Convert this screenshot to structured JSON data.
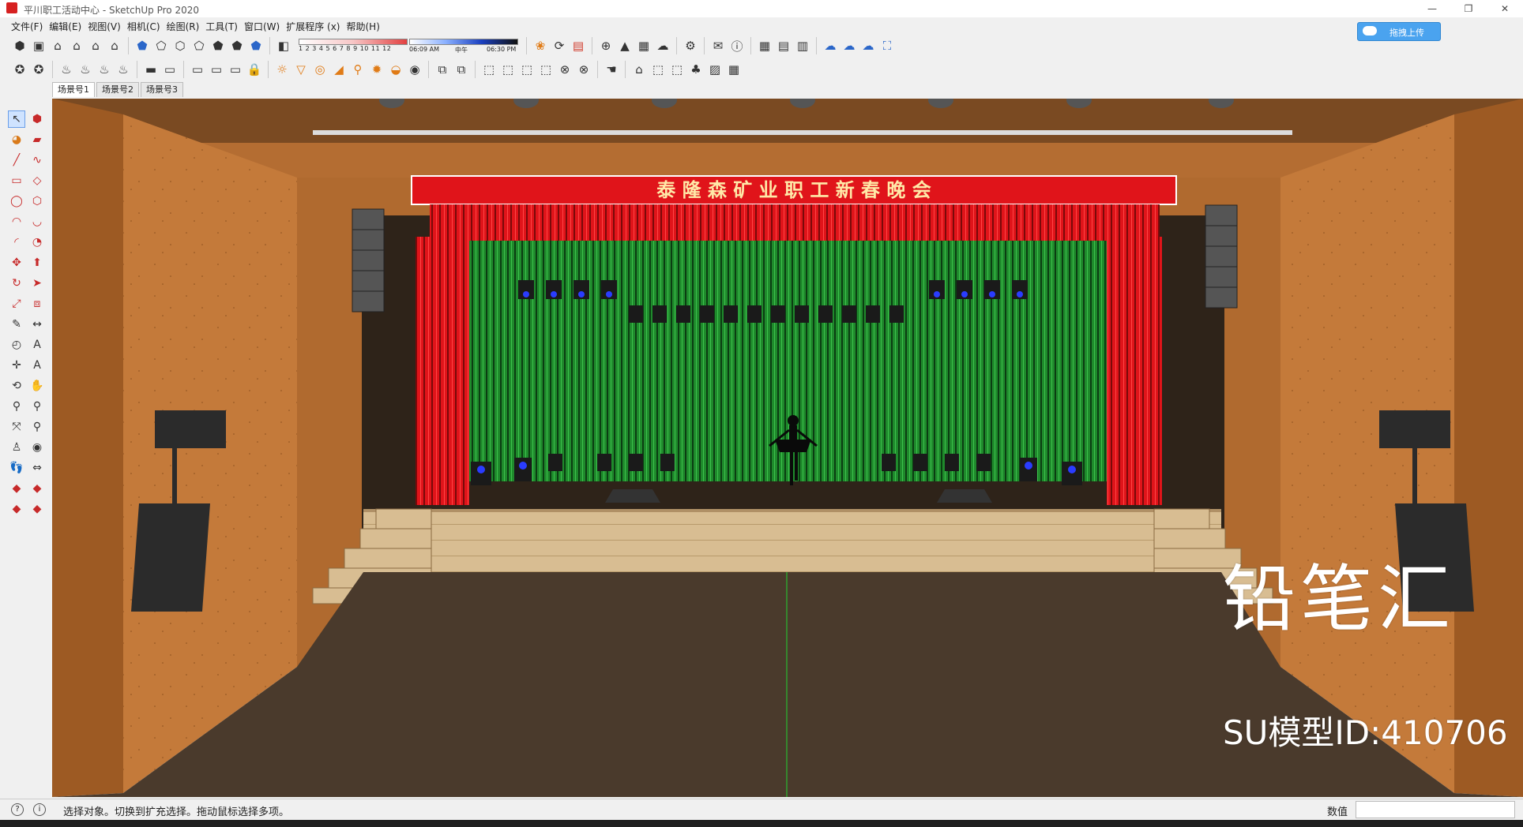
{
  "window": {
    "title": "平川职工活动中心 - SketchUp Pro 2020",
    "controls": [
      "—",
      "❐",
      "✕"
    ]
  },
  "upload_button": {
    "label": "拖拽上传"
  },
  "menu": [
    "文件(F)",
    "编辑(E)",
    "视图(V)",
    "相机(C)",
    "绘图(R)",
    "工具(T)",
    "窗口(W)",
    "扩展程序 (x)",
    "帮助(H)"
  ],
  "shadow": {
    "months": "1 2 3 4 5 6 7 8 9 10 11 12",
    "time_start": "06:09 AM",
    "time_mid": "中午",
    "time_end": "06:30 PM"
  },
  "scenes": [
    "场景号1",
    "场景号2",
    "场景号3"
  ],
  "scene": {
    "banner_text": "泰 隆 森 矿 业 职 工 新 春 晚 会",
    "colors": {
      "wood": "#c47a3a",
      "curtain_red": "#e0141a",
      "curtain_green": "#1f8a2c",
      "floor": "#4a3a2c",
      "stage_floor": "#2e2319"
    }
  },
  "status": {
    "text": "选择对象。切换到扩充选择。拖动鼠标选择多项。",
    "measure_label": "数值",
    "measure_value": ""
  },
  "watermark": {
    "brand": "铅笔汇",
    "model_id": "SU模型ID:410706"
  }
}
